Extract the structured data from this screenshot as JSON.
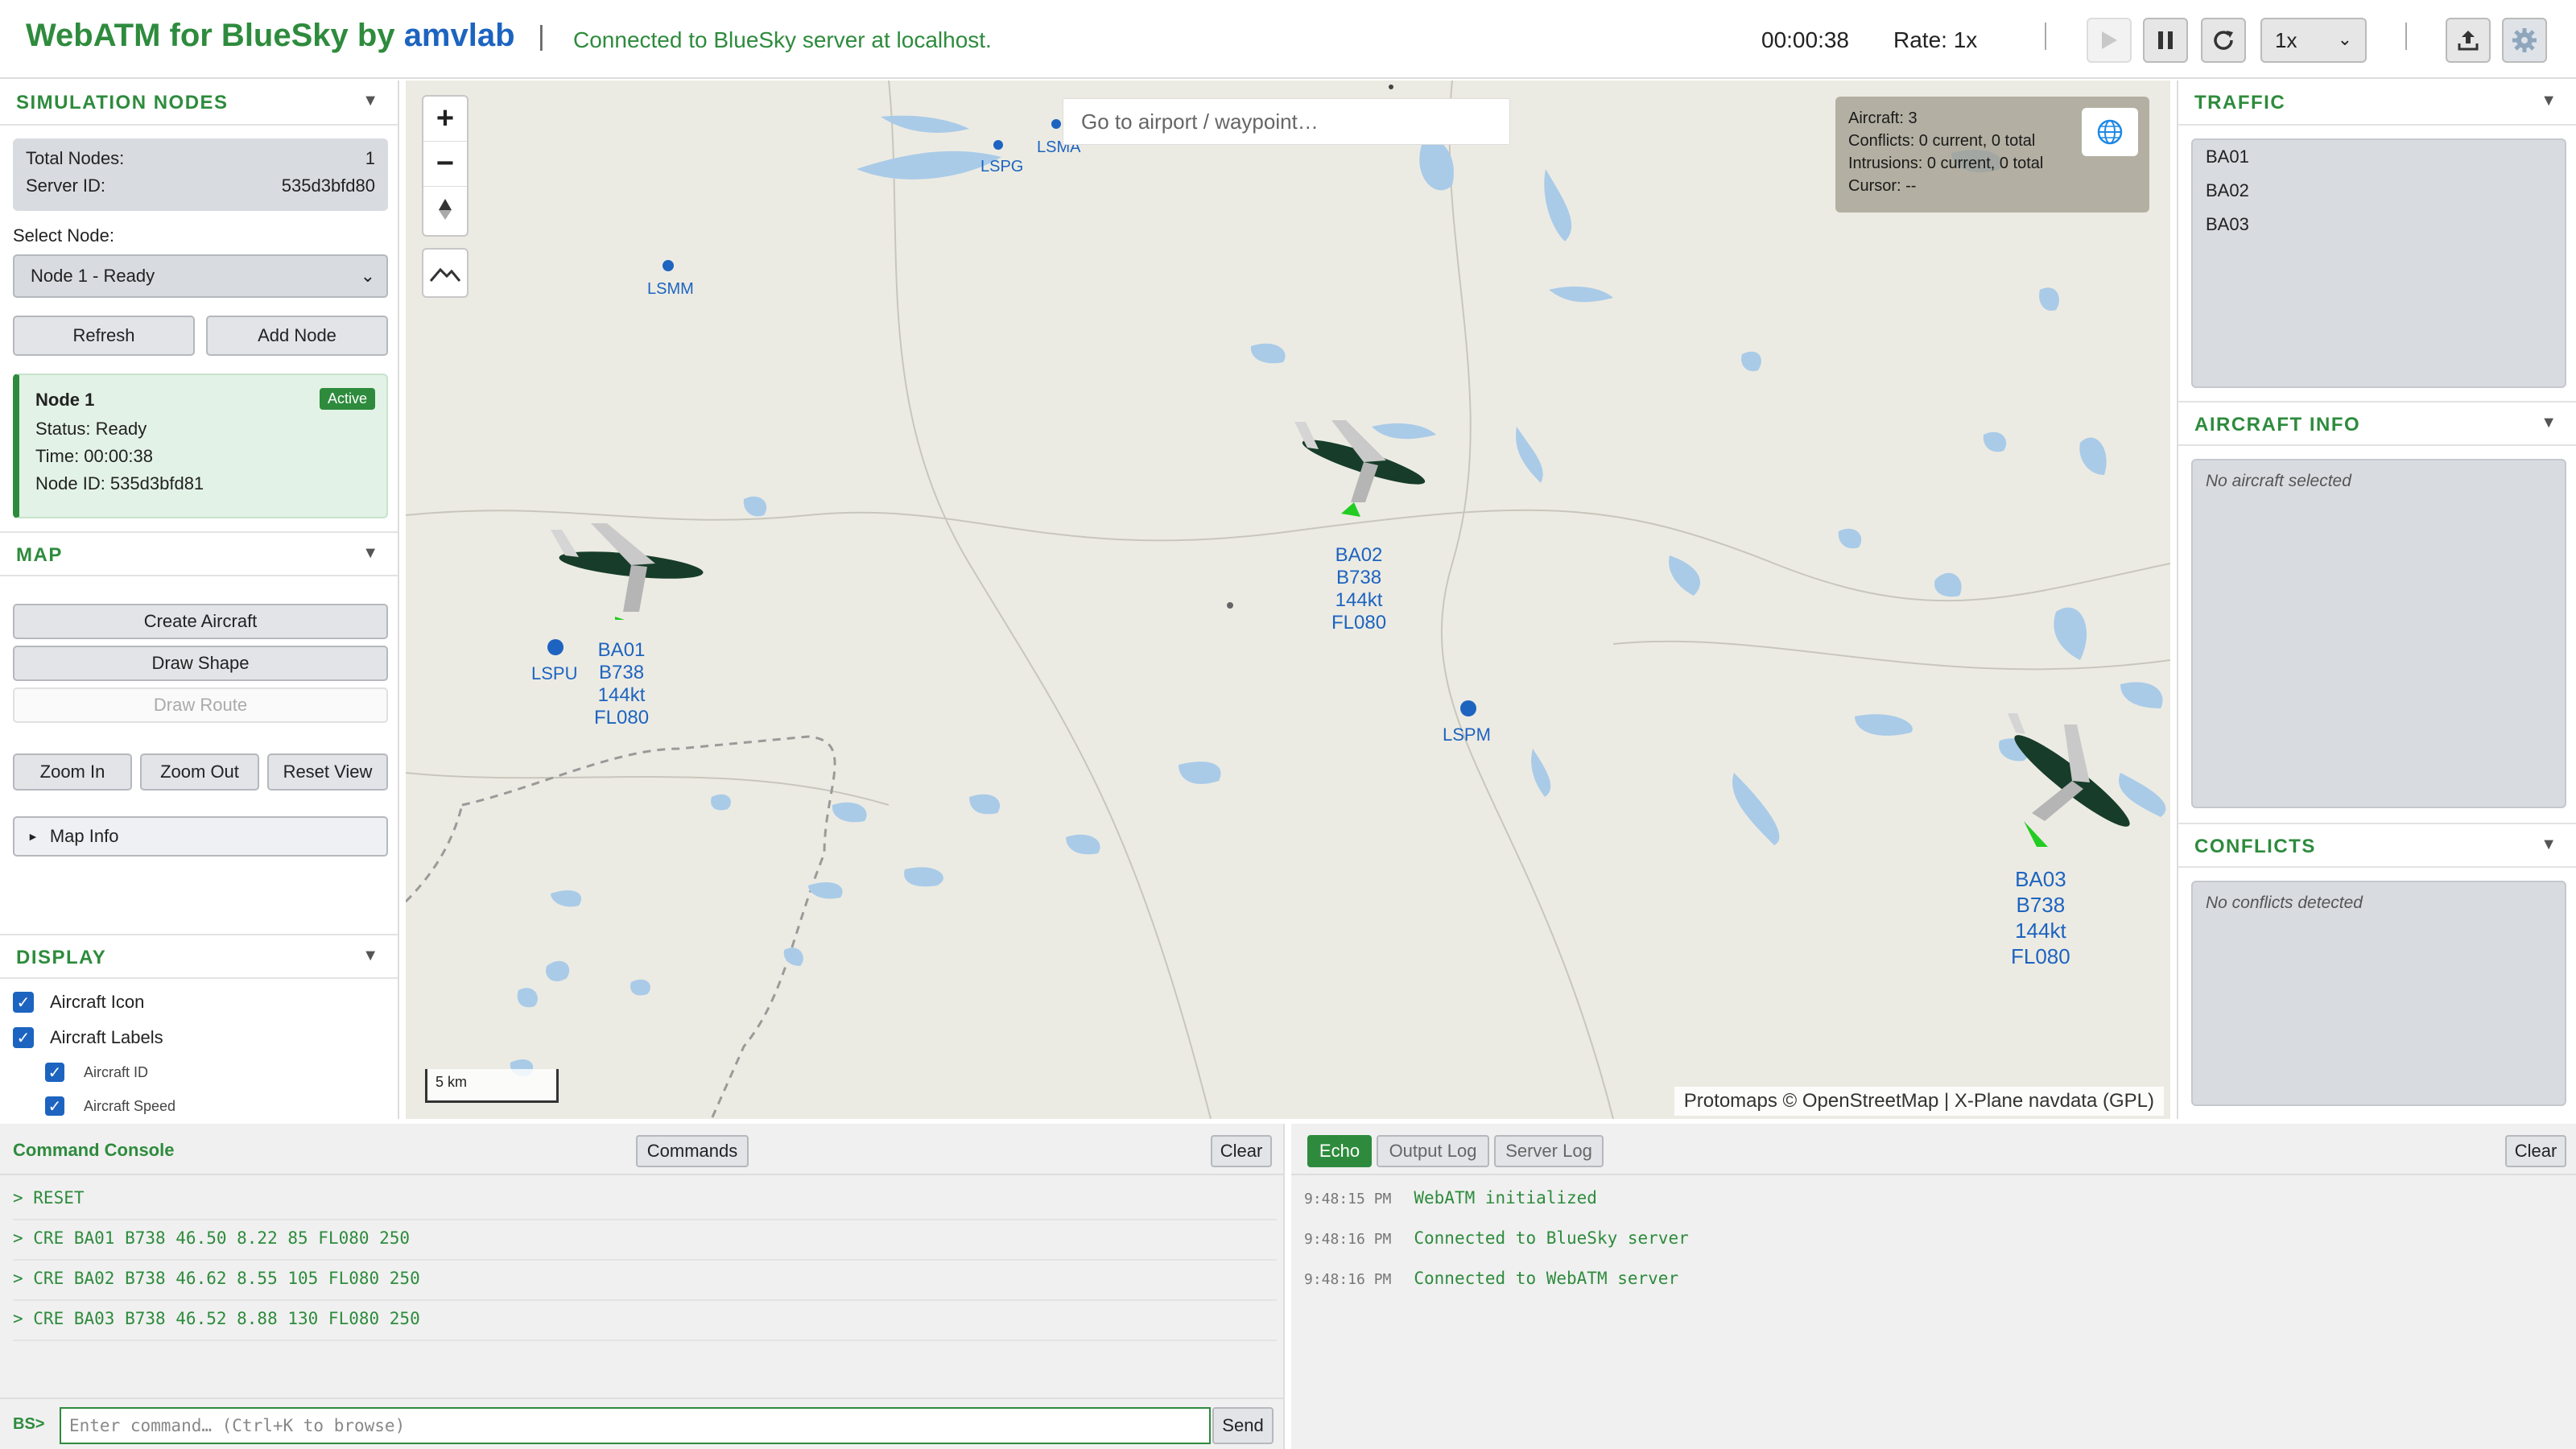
{
  "header": {
    "title_main": "WebATM for BlueSky by ",
    "title_brand": "amvlab",
    "separator": "|",
    "status": "Connected to BlueSky server at localhost.",
    "sim_time": "00:00:38",
    "rate": "Rate: 1x",
    "speed_value": "1x"
  },
  "left": {
    "sim_nodes": {
      "title": "SIMULATION NODES",
      "total_label": "Total Nodes:",
      "total_value": "1",
      "server_label": "Server ID:",
      "server_value": "535d3bfd80",
      "select_label": "Select Node:",
      "select_value": "Node 1 - Ready",
      "refresh": "Refresh",
      "add_node": "Add Node",
      "card": {
        "name": "Node 1",
        "badge": "Active",
        "status": "Status: Ready",
        "time": "Time: 00:00:38",
        "node_id": "Node ID: 535d3bfd81"
      }
    },
    "map": {
      "title": "MAP",
      "create_aircraft": "Create Aircraft",
      "draw_shape": "Draw Shape",
      "draw_route": "Draw Route",
      "zoom_in": "Zoom In",
      "zoom_out": "Zoom Out",
      "reset_view": "Reset View",
      "map_info": "Map Info"
    },
    "display": {
      "title": "DISPLAY",
      "aircraft_icon": "Aircraft Icon",
      "aircraft_labels": "Aircraft Labels",
      "aircraft_id": "Aircraft ID",
      "aircraft_speed": "Aircraft Speed"
    }
  },
  "map": {
    "goto_placeholder": "Go to airport / waypoint…",
    "stats": {
      "aircraft": "Aircraft: 3",
      "conflicts": "Conflicts: 0 current, 0 total",
      "intrusions": "Intrusions: 0 current, 0 total",
      "cursor": "Cursor: --"
    },
    "airports": [
      "LSMA",
      "LSPG",
      "LSMM",
      "LSPU",
      "LSPM"
    ],
    "aircraft": [
      {
        "id": "BA01",
        "type": "B738",
        "speed": "144kt",
        "fl": "FL080"
      },
      {
        "id": "BA02",
        "type": "B738",
        "speed": "144kt",
        "fl": "FL080"
      },
      {
        "id": "BA03",
        "type": "B738",
        "speed": "144kt",
        "fl": "FL080"
      }
    ],
    "scale": "5 km",
    "attribution": "Protomaps © OpenStreetMap | X-Plane navdata (GPL)"
  },
  "right": {
    "traffic": {
      "title": "TRAFFIC",
      "items": [
        "BA01",
        "BA02",
        "BA03"
      ]
    },
    "aircraft_info": {
      "title": "AIRCRAFT INFO",
      "empty": "No aircraft selected"
    },
    "conflicts": {
      "title": "CONFLICTS",
      "empty": "No conflicts detected"
    }
  },
  "console": {
    "title": "Command Console",
    "commands_btn": "Commands",
    "clear_btn": "Clear",
    "lines": [
      "> RESET",
      "> CRE BA01 B738 46.50 8.22 85 FL080 250",
      "> CRE BA02 B738 46.62 8.55 105 FL080 250",
      "> CRE BA03 B738 46.52 8.88 130 FL080 250"
    ],
    "prompt": "BS>",
    "input_placeholder": "Enter command… (Ctrl+K to browse)",
    "send": "Send"
  },
  "log": {
    "tabs": [
      "Echo",
      "Output Log",
      "Server Log"
    ],
    "clear_btn": "Clear",
    "entries": [
      {
        "time": "9:48:15 PM",
        "msg": "WebATM initialized"
      },
      {
        "time": "9:48:16 PM",
        "msg": "Connected to BlueSky server"
      },
      {
        "time": "9:48:16 PM",
        "msg": "Connected to WebATM server"
      }
    ]
  },
  "colors": {
    "accent_green": "#2e8b3d",
    "brand_blue": "#1d64c0",
    "map_bg": "#ecebe3",
    "water": "#a9cbe8"
  }
}
